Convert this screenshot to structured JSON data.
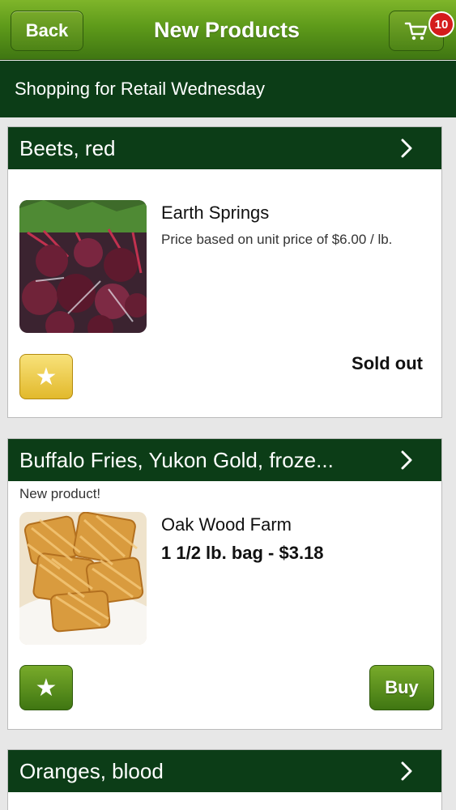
{
  "header": {
    "back_label": "Back",
    "title": "New Products",
    "cart_count": "10"
  },
  "subheader": {
    "text": "Shopping for Retail Wednesday"
  },
  "products": [
    {
      "name": "Beets, red",
      "badge": "",
      "farm": "Earth Springs",
      "price": "Price based on unit price of $6.00 / lb.",
      "status": "Sold out",
      "action": "",
      "favorite_style": "yellow",
      "image": "beets-photo"
    },
    {
      "name": "Buffalo Fries, Yukon Gold, froze...",
      "badge": "New product!",
      "farm": "Oak Wood Farm",
      "price": "1 1/2 lb. bag - $3.18",
      "status": "",
      "action": "Buy",
      "favorite_style": "green",
      "image": "waffle-fries-photo"
    },
    {
      "name": "Oranges, blood"
    }
  ],
  "icons": {
    "cart": "cart-icon",
    "chevron": "chevron-right-icon",
    "favorite": "star-icon"
  },
  "colors": {
    "brand_green": "#5e9a1a",
    "dark_green": "#0c3d17",
    "badge_red": "#d41c1c",
    "favorite_yellow": "#e2b92c"
  }
}
